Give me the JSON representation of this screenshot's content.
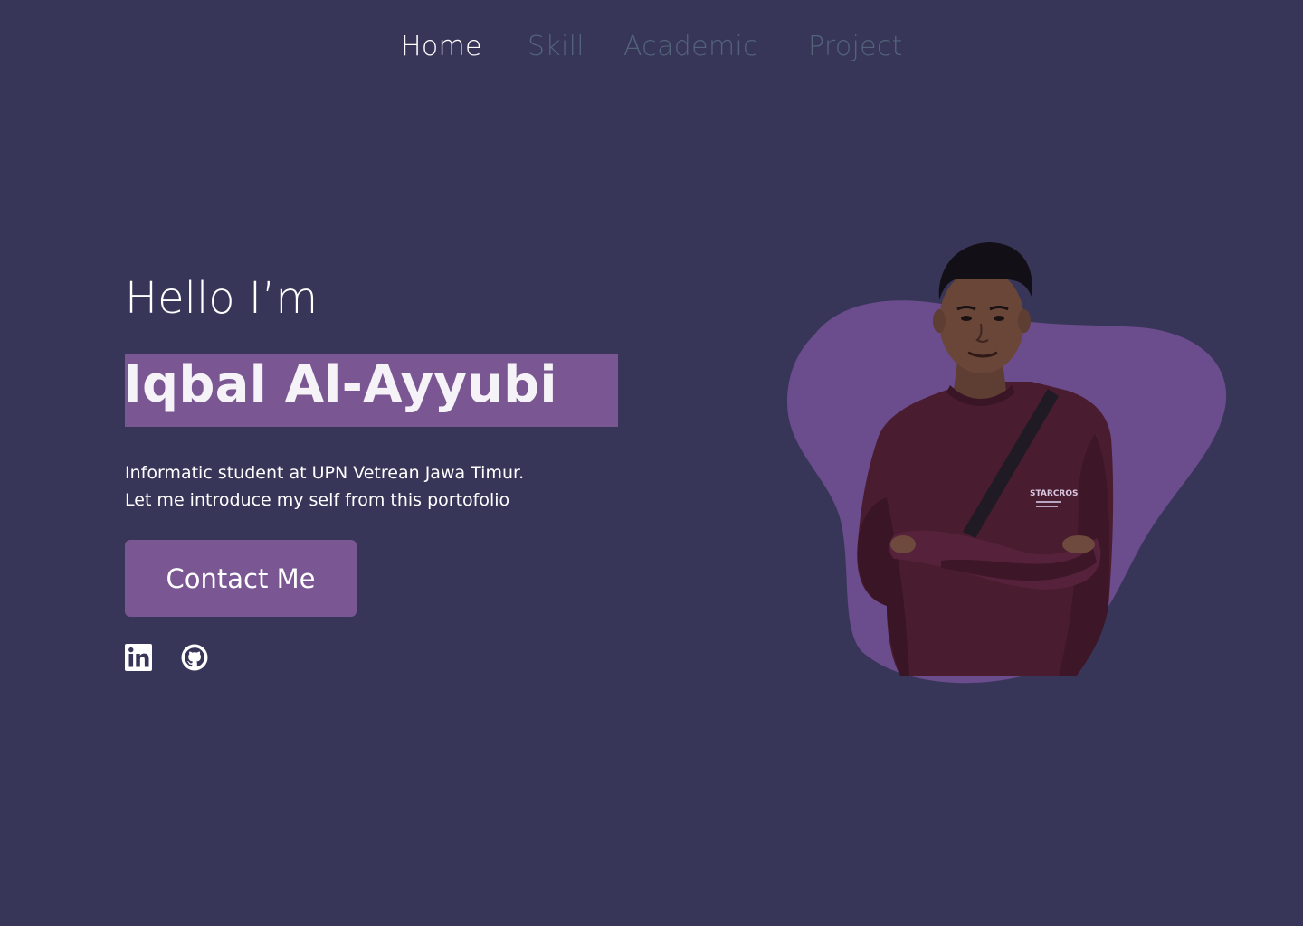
{
  "nav": {
    "items": [
      {
        "label": "Home",
        "active": true
      },
      {
        "label": "Skill",
        "active": false
      },
      {
        "label": "Academic",
        "active": false
      },
      {
        "label": "Project",
        "active": false
      }
    ]
  },
  "hero": {
    "greeting": "Hello I’m",
    "name": "Iqbal Al-Ayyubi",
    "description_line1": "Informatic student at UPN Vetrean Jawa Timur.",
    "description_line2": "Let me introduce my self from this portofolio",
    "cta_label": "Contact Me",
    "shirt_text": "STARCROS"
  },
  "social": [
    {
      "icon": "linkedin-icon"
    },
    {
      "icon": "github-icon"
    }
  ],
  "colors": {
    "background": "#383658",
    "accent": "#7a5693",
    "blob": "#6b4c8c",
    "nav_inactive": "#52637a",
    "text": "#ffffff"
  }
}
